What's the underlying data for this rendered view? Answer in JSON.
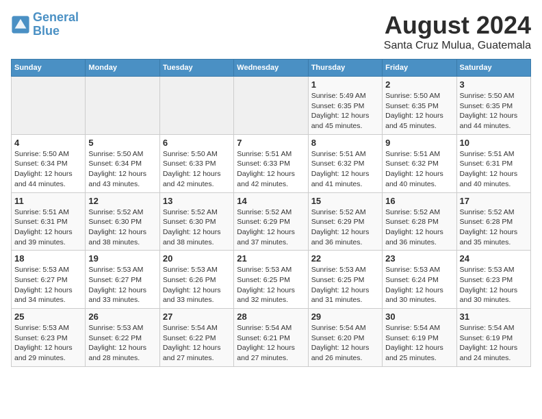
{
  "header": {
    "logo_line1": "General",
    "logo_line2": "Blue",
    "title": "August 2024",
    "subtitle": "Santa Cruz Mulua, Guatemala"
  },
  "weekdays": [
    "Sunday",
    "Monday",
    "Tuesday",
    "Wednesday",
    "Thursday",
    "Friday",
    "Saturday"
  ],
  "weeks": [
    [
      {
        "day": "",
        "info": ""
      },
      {
        "day": "",
        "info": ""
      },
      {
        "day": "",
        "info": ""
      },
      {
        "day": "",
        "info": ""
      },
      {
        "day": "1",
        "info": "Sunrise: 5:49 AM\nSunset: 6:35 PM\nDaylight: 12 hours\nand 45 minutes."
      },
      {
        "day": "2",
        "info": "Sunrise: 5:50 AM\nSunset: 6:35 PM\nDaylight: 12 hours\nand 45 minutes."
      },
      {
        "day": "3",
        "info": "Sunrise: 5:50 AM\nSunset: 6:35 PM\nDaylight: 12 hours\nand 44 minutes."
      }
    ],
    [
      {
        "day": "4",
        "info": "Sunrise: 5:50 AM\nSunset: 6:34 PM\nDaylight: 12 hours\nand 44 minutes."
      },
      {
        "day": "5",
        "info": "Sunrise: 5:50 AM\nSunset: 6:34 PM\nDaylight: 12 hours\nand 43 minutes."
      },
      {
        "day": "6",
        "info": "Sunrise: 5:50 AM\nSunset: 6:33 PM\nDaylight: 12 hours\nand 42 minutes."
      },
      {
        "day": "7",
        "info": "Sunrise: 5:51 AM\nSunset: 6:33 PM\nDaylight: 12 hours\nand 42 minutes."
      },
      {
        "day": "8",
        "info": "Sunrise: 5:51 AM\nSunset: 6:32 PM\nDaylight: 12 hours\nand 41 minutes."
      },
      {
        "day": "9",
        "info": "Sunrise: 5:51 AM\nSunset: 6:32 PM\nDaylight: 12 hours\nand 40 minutes."
      },
      {
        "day": "10",
        "info": "Sunrise: 5:51 AM\nSunset: 6:31 PM\nDaylight: 12 hours\nand 40 minutes."
      }
    ],
    [
      {
        "day": "11",
        "info": "Sunrise: 5:51 AM\nSunset: 6:31 PM\nDaylight: 12 hours\nand 39 minutes."
      },
      {
        "day": "12",
        "info": "Sunrise: 5:52 AM\nSunset: 6:30 PM\nDaylight: 12 hours\nand 38 minutes."
      },
      {
        "day": "13",
        "info": "Sunrise: 5:52 AM\nSunset: 6:30 PM\nDaylight: 12 hours\nand 38 minutes."
      },
      {
        "day": "14",
        "info": "Sunrise: 5:52 AM\nSunset: 6:29 PM\nDaylight: 12 hours\nand 37 minutes."
      },
      {
        "day": "15",
        "info": "Sunrise: 5:52 AM\nSunset: 6:29 PM\nDaylight: 12 hours\nand 36 minutes."
      },
      {
        "day": "16",
        "info": "Sunrise: 5:52 AM\nSunset: 6:28 PM\nDaylight: 12 hours\nand 36 minutes."
      },
      {
        "day": "17",
        "info": "Sunrise: 5:52 AM\nSunset: 6:28 PM\nDaylight: 12 hours\nand 35 minutes."
      }
    ],
    [
      {
        "day": "18",
        "info": "Sunrise: 5:53 AM\nSunset: 6:27 PM\nDaylight: 12 hours\nand 34 minutes."
      },
      {
        "day": "19",
        "info": "Sunrise: 5:53 AM\nSunset: 6:27 PM\nDaylight: 12 hours\nand 33 minutes."
      },
      {
        "day": "20",
        "info": "Sunrise: 5:53 AM\nSunset: 6:26 PM\nDaylight: 12 hours\nand 33 minutes."
      },
      {
        "day": "21",
        "info": "Sunrise: 5:53 AM\nSunset: 6:25 PM\nDaylight: 12 hours\nand 32 minutes."
      },
      {
        "day": "22",
        "info": "Sunrise: 5:53 AM\nSunset: 6:25 PM\nDaylight: 12 hours\nand 31 minutes."
      },
      {
        "day": "23",
        "info": "Sunrise: 5:53 AM\nSunset: 6:24 PM\nDaylight: 12 hours\nand 30 minutes."
      },
      {
        "day": "24",
        "info": "Sunrise: 5:53 AM\nSunset: 6:23 PM\nDaylight: 12 hours\nand 30 minutes."
      }
    ],
    [
      {
        "day": "25",
        "info": "Sunrise: 5:53 AM\nSunset: 6:23 PM\nDaylight: 12 hours\nand 29 minutes."
      },
      {
        "day": "26",
        "info": "Sunrise: 5:53 AM\nSunset: 6:22 PM\nDaylight: 12 hours\nand 28 minutes."
      },
      {
        "day": "27",
        "info": "Sunrise: 5:54 AM\nSunset: 6:22 PM\nDaylight: 12 hours\nand 27 minutes."
      },
      {
        "day": "28",
        "info": "Sunrise: 5:54 AM\nSunset: 6:21 PM\nDaylight: 12 hours\nand 27 minutes."
      },
      {
        "day": "29",
        "info": "Sunrise: 5:54 AM\nSunset: 6:20 PM\nDaylight: 12 hours\nand 26 minutes."
      },
      {
        "day": "30",
        "info": "Sunrise: 5:54 AM\nSunset: 6:19 PM\nDaylight: 12 hours\nand 25 minutes."
      },
      {
        "day": "31",
        "info": "Sunrise: 5:54 AM\nSunset: 6:19 PM\nDaylight: 12 hours\nand 24 minutes."
      }
    ]
  ]
}
